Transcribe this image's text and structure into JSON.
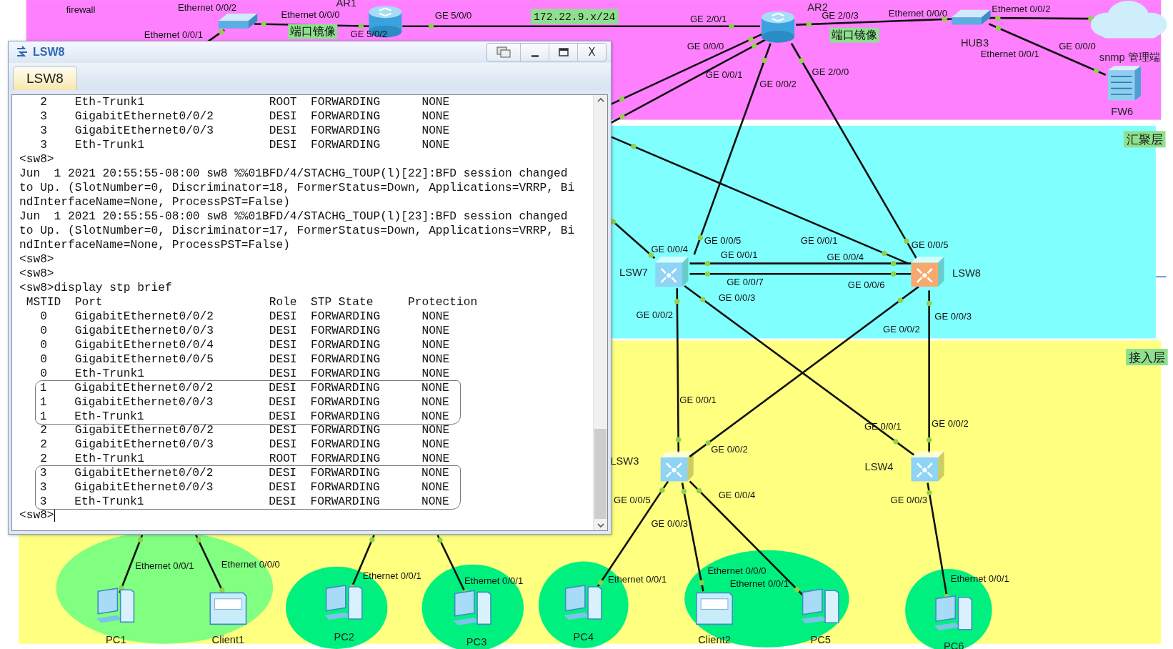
{
  "topology": {
    "zones": [
      {
        "color": "#ff80ff"
      },
      {
        "color": "#80ffff",
        "label": "汇聚层"
      },
      {
        "color": "#ffff80",
        "label": "接入层"
      }
    ],
    "nodes": [
      {
        "kind": "hub"
      },
      {
        "kind": "router",
        "label": "AR1"
      },
      {
        "kind": "router",
        "label": "AR2"
      },
      {
        "kind": "hub",
        "label": "HUB3"
      },
      {
        "kind": "cloud",
        "label": "snmp 管理端"
      },
      {
        "kind": "firewall",
        "label": "FW6"
      },
      {
        "kind": "switch",
        "label": "LSW7",
        "color": "#8fd3f5"
      },
      {
        "kind": "switch",
        "label": "LSW8",
        "color": "#f8a86e"
      },
      {
        "kind": "switch",
        "label": "LSW3",
        "color": "#8fd3f5"
      },
      {
        "kind": "switch",
        "label": "LSW4",
        "color": "#8fd3f5"
      },
      {
        "kind": "pc",
        "label": "PC1"
      },
      {
        "kind": "client",
        "label": "Client1"
      },
      {
        "kind": "pc",
        "label": "PC2"
      },
      {
        "kind": "pc",
        "label": "PC3"
      },
      {
        "kind": "pc",
        "label": "PC4"
      },
      {
        "kind": "client",
        "label": "Client2"
      },
      {
        "kind": "pc",
        "label": "PC5"
      },
      {
        "kind": "pc",
        "label": "PC6"
      }
    ],
    "tags": [
      "端口镜像",
      "172.22.9.x/24",
      "端口镜像"
    ],
    "labels": [
      "firewall",
      "Ethernet 0/0/2",
      "Ethernet 0/0/1",
      "Ethernet 0/0/0",
      "GE 5/0/2",
      "GE 5/0/0",
      "GE 2/0/1",
      "GE 2/0/3",
      "Ethernet 0/0/0",
      "Ethernet 0/0/2",
      "Ethernet 0/0/1",
      "GE 0/0/0",
      "GE 0/0/0",
      "GE 0/0/1",
      "GE 0/0/2",
      "GE 2/0/0",
      "GE 0/0/4",
      "GE 0/0/5",
      "GE 0/0/1",
      "GE 0/0/7",
      "GE 0/0/3",
      "GE 0/0/2",
      "GE 0/0/1",
      "GE 0/0/5",
      "GE 0/0/4",
      "GE 0/0/6",
      "GE 0/0/2",
      "GE 0/0/3",
      "GE 0/0/1",
      "GE 0/0/2",
      "GE 0/0/1",
      "GE 0/0/2",
      "GE 0/0/5",
      "GE 0/0/3",
      "GE 0/0/4",
      "GE 0/0/3",
      "Ethernet 0/0/1",
      "Ethernet 0/0/0",
      "Ethernet 0/0/1",
      "Ethernet 0/0/1",
      "Ethernet 0/0/1",
      "Ethernet 0/0/0",
      "Ethernet 0/0/1",
      "Ethernet 0/0/1"
    ]
  },
  "console": {
    "title": "LSW8",
    "close_label": "X",
    "tabs": [
      {
        "label": "LSW8",
        "selected": true
      }
    ],
    "lines": [
      {
        "text": "   2    Eth-Trunk1                  ROOT  FORWARDING      NONE",
        "circled": false
      },
      {
        "text": "   3    GigabitEthernet0/0/2        DESI  FORWARDING      NONE",
        "circled": false
      },
      {
        "text": "   3    GigabitEthernet0/0/3        DESI  FORWARDING      NONE",
        "circled": false
      },
      {
        "text": "   3    Eth-Trunk1                  DESI  FORWARDING      NONE",
        "circled": false
      },
      {
        "text": "<sw8>",
        "circled": false
      },
      {
        "text": "Jun  1 2021 20:55:55-08:00 sw8 %%01BFD/4/STACHG_TOUP(l)[22]:BFD session changed",
        "circled": false
      },
      {
        "text": "to Up. (SlotNumber=0, Discriminator=18, FormerStatus=Down, Applications=VRRP, Bi",
        "circled": false
      },
      {
        "text": "ndInterfaceName=None, ProcessPST=False)",
        "circled": false
      },
      {
        "text": "Jun  1 2021 20:55:55-08:00 sw8 %%01BFD/4/STACHG_TOUP(l)[23]:BFD session changed",
        "circled": false
      },
      {
        "text": "to Up. (SlotNumber=0, Discriminator=17, FormerStatus=Down, Applications=VRRP, Bi",
        "circled": false
      },
      {
        "text": "ndInterfaceName=None, ProcessPST=False)",
        "circled": false
      },
      {
        "text": "<sw8>",
        "circled": false
      },
      {
        "text": "<sw8>",
        "circled": false
      },
      {
        "text": "<sw8>display stp brief",
        "circled": false
      },
      {
        "text": " MSTID  Port                        Role  STP State     Protection",
        "circled": false
      },
      {
        "text": "   0    GigabitEthernet0/0/2        DESI  FORWARDING      NONE",
        "circled": false
      },
      {
        "text": "   0    GigabitEthernet0/0/3        DESI  FORWARDING      NONE",
        "circled": false
      },
      {
        "text": "   0    GigabitEthernet0/0/4        DESI  FORWARDING      NONE",
        "circled": false
      },
      {
        "text": "   0    GigabitEthernet0/0/5        DESI  FORWARDING      NONE",
        "circled": false
      },
      {
        "text": "   0    Eth-Trunk1                  DESI  FORWARDING      NONE",
        "circled": false
      },
      {
        "text": "   1    GigabitEthernet0/0/2        DESI  FORWARDING      NONE",
        "circled": true
      },
      {
        "text": "   1    GigabitEthernet0/0/3        DESI  FORWARDING      NONE",
        "circled": true
      },
      {
        "text": "   1    Eth-Trunk1                  DESI  FORWARDING      NONE",
        "circled": true
      },
      {
        "text": "   2    GigabitEthernet0/0/2        DESI  FORWARDING      NONE",
        "circled": false
      },
      {
        "text": "   2    GigabitEthernet0/0/3        DESI  FORWARDING      NONE",
        "circled": false
      },
      {
        "text": "   2    Eth-Trunk1                  ROOT  FORWARDING      NONE",
        "circled": false
      },
      {
        "text": "   3    GigabitEthernet0/0/2        DESI  FORWARDING      NONE",
        "circled": true
      },
      {
        "text": "   3    GigabitEthernet0/0/3        DESI  FORWARDING      NONE",
        "circled": true
      },
      {
        "text": "   3    Eth-Trunk1                  DESI  FORWARDING      NONE",
        "circled": true
      }
    ],
    "prompt": "<sw8>"
  }
}
